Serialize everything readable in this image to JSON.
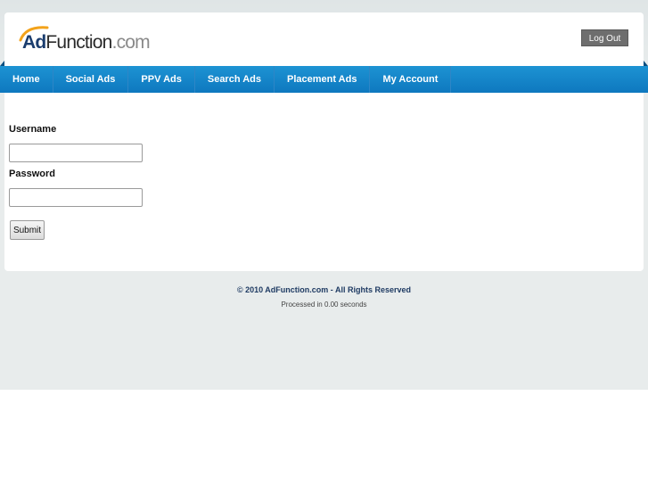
{
  "header": {
    "logo": {
      "ad": "Ad",
      "function": "Function",
      "domain": ".com"
    },
    "logout_label": "Log Out"
  },
  "nav": {
    "items": [
      {
        "label": "Home"
      },
      {
        "label": "Social Ads"
      },
      {
        "label": "PPV Ads"
      },
      {
        "label": "Search Ads"
      },
      {
        "label": "Placement Ads"
      },
      {
        "label": "My Account"
      }
    ]
  },
  "login_form": {
    "username_label": "Username",
    "username_value": "",
    "password_label": "Password",
    "password_value": "",
    "submit_label": "Submit"
  },
  "footer": {
    "copyright": "© 2010 AdFunction.com - All Rights Reserved",
    "processed": "Processed in 0.00 seconds"
  },
  "colors": {
    "nav_blue": "#1488cd",
    "logo_orange": "#f3a21a",
    "logo_navy": "#1b3d6e",
    "page_bg": "#e8ecec"
  }
}
